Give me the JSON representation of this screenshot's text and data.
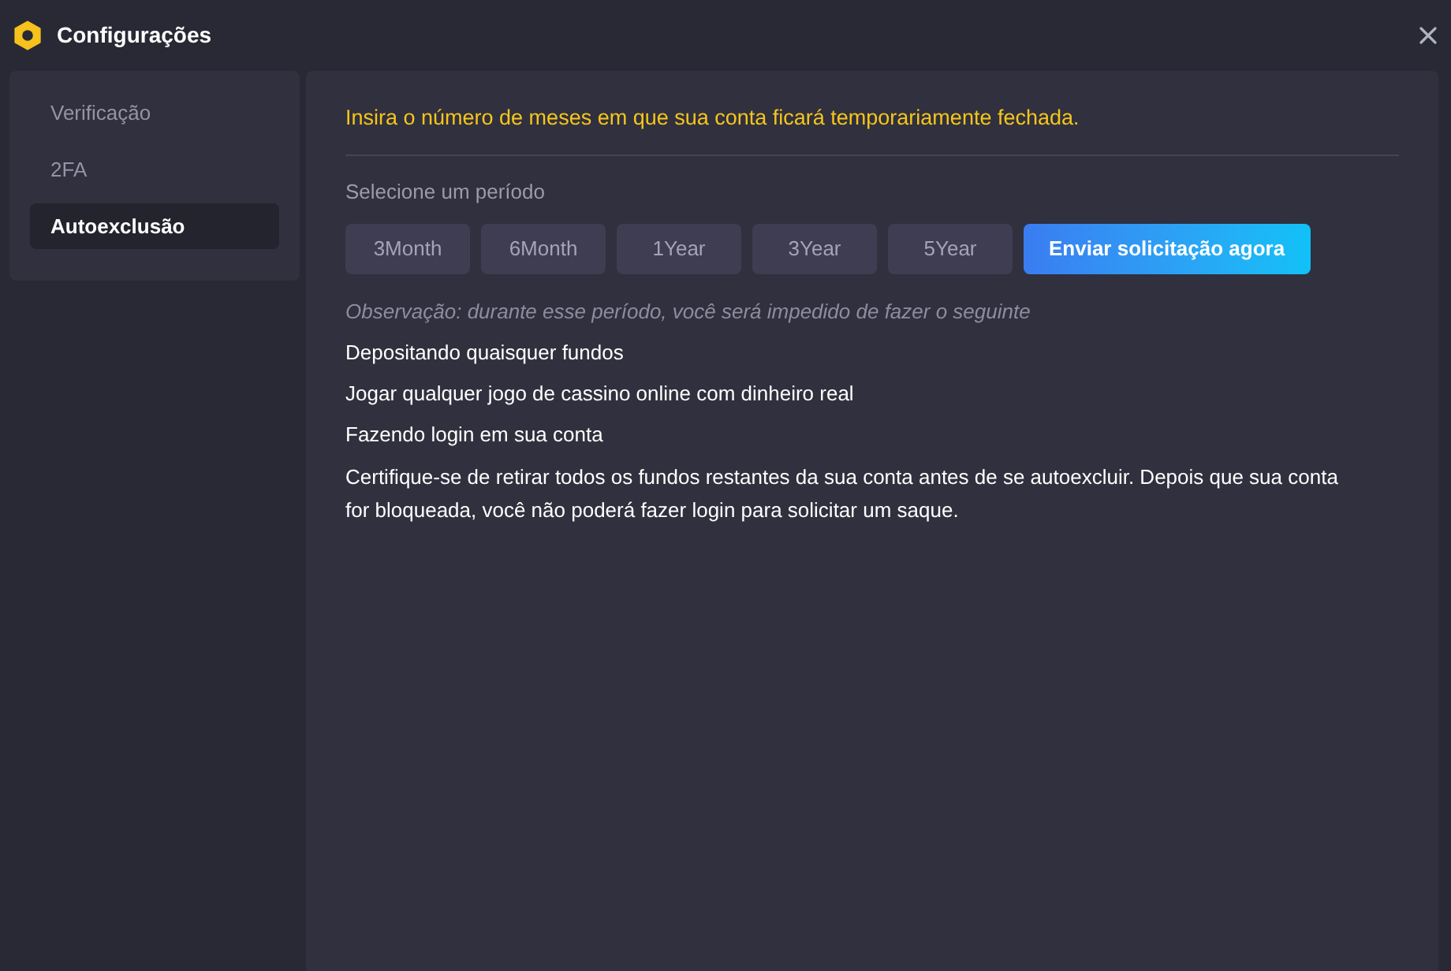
{
  "window": {
    "title": "Configurações"
  },
  "sidebar": {
    "items": [
      {
        "label": "Verificação",
        "selected": false
      },
      {
        "label": "2FA",
        "selected": false
      },
      {
        "label": "Autoexclusão",
        "selected": true
      }
    ]
  },
  "content": {
    "notice": "Insira o número de meses em que sua conta ficará temporariamente fechada.",
    "period_label": "Selecione um período",
    "periods": [
      {
        "label": "3Month",
        "selected": false
      },
      {
        "label": "6Month",
        "selected": false
      },
      {
        "label": "1Year",
        "selected": false
      },
      {
        "label": "3Year",
        "selected": false
      },
      {
        "label": "5Year",
        "selected": false
      }
    ],
    "submit_button": "Enviar solicitação agora",
    "note": "Observação: durante esse período, você será impedido de fazer o seguinte",
    "restrictions": [
      "Depositando quaisquer fundos",
      "Jogar qualquer jogo de cassino online com dinheiro real",
      "Fazendo login em sua conta"
    ],
    "warning": "Certifique-se de retirar todos os fundos restantes da sua conta antes de se autoexcluir. Depois que sua conta for bloqueada, você não poderá fazer login para solicitar um saque."
  }
}
